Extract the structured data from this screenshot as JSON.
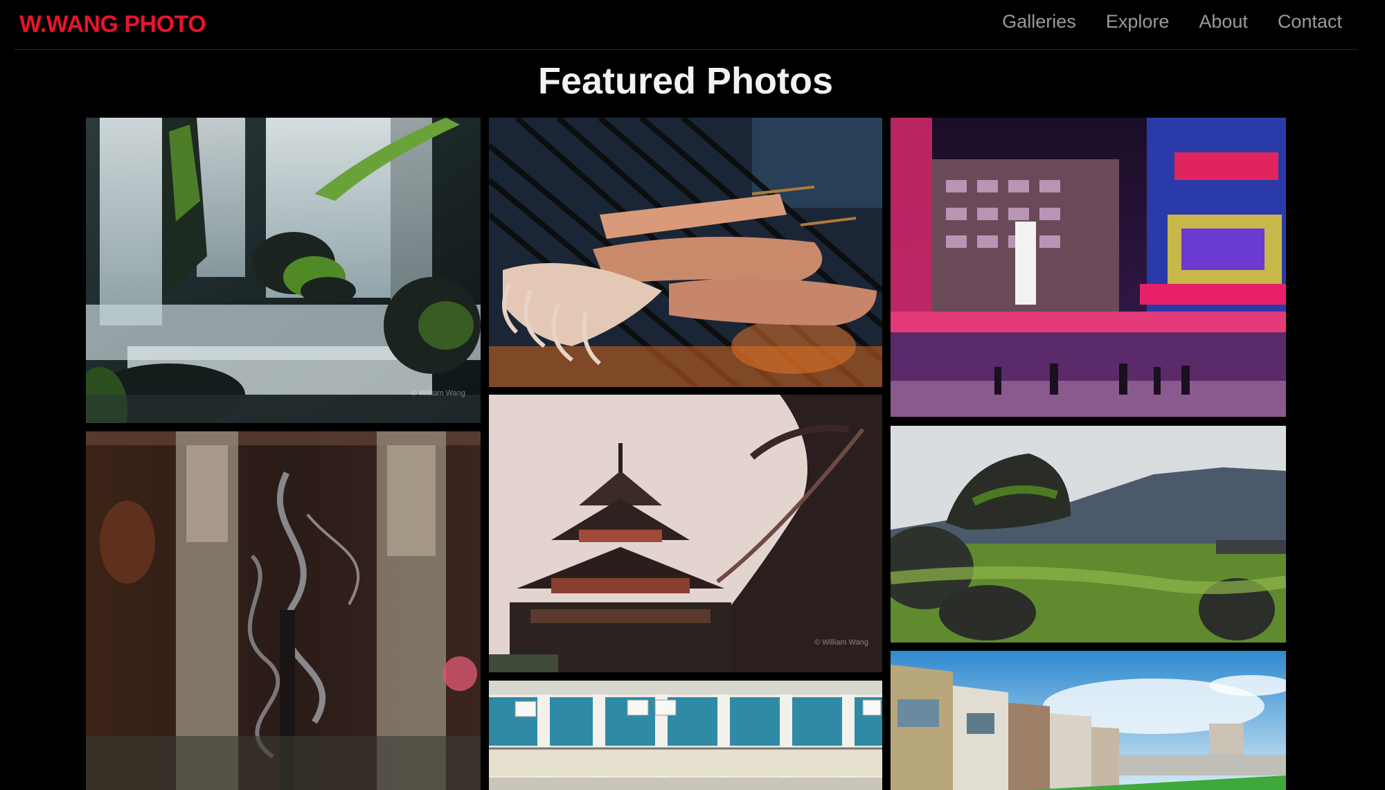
{
  "site": {
    "logo": "W.WANG PHOTO"
  },
  "nav": [
    {
      "label": "Galleries"
    },
    {
      "label": "Explore"
    },
    {
      "label": "About"
    },
    {
      "label": "Contact"
    }
  ],
  "page": {
    "title": "Featured Photos"
  },
  "colors": {
    "brand": "#e8142c",
    "background": "#000000",
    "nav_text": "#9a9a9a"
  },
  "photos": [
    {
      "subject": "waterfall",
      "watermark": "© William Wang"
    },
    {
      "subject": "grilled squid skewers",
      "watermark": ""
    },
    {
      "subject": "neon city street at night",
      "watermark": ""
    },
    {
      "subject": "incense smoke between stone pillars",
      "watermark": ""
    },
    {
      "subject": "temple roof pagoda",
      "watermark": "© William Wang"
    },
    {
      "subject": "green coastal rocks and mountains",
      "watermark": ""
    },
    {
      "subject": "white apartment balconies",
      "watermark": ""
    },
    {
      "subject": "old houses by green field",
      "watermark": ""
    }
  ]
}
